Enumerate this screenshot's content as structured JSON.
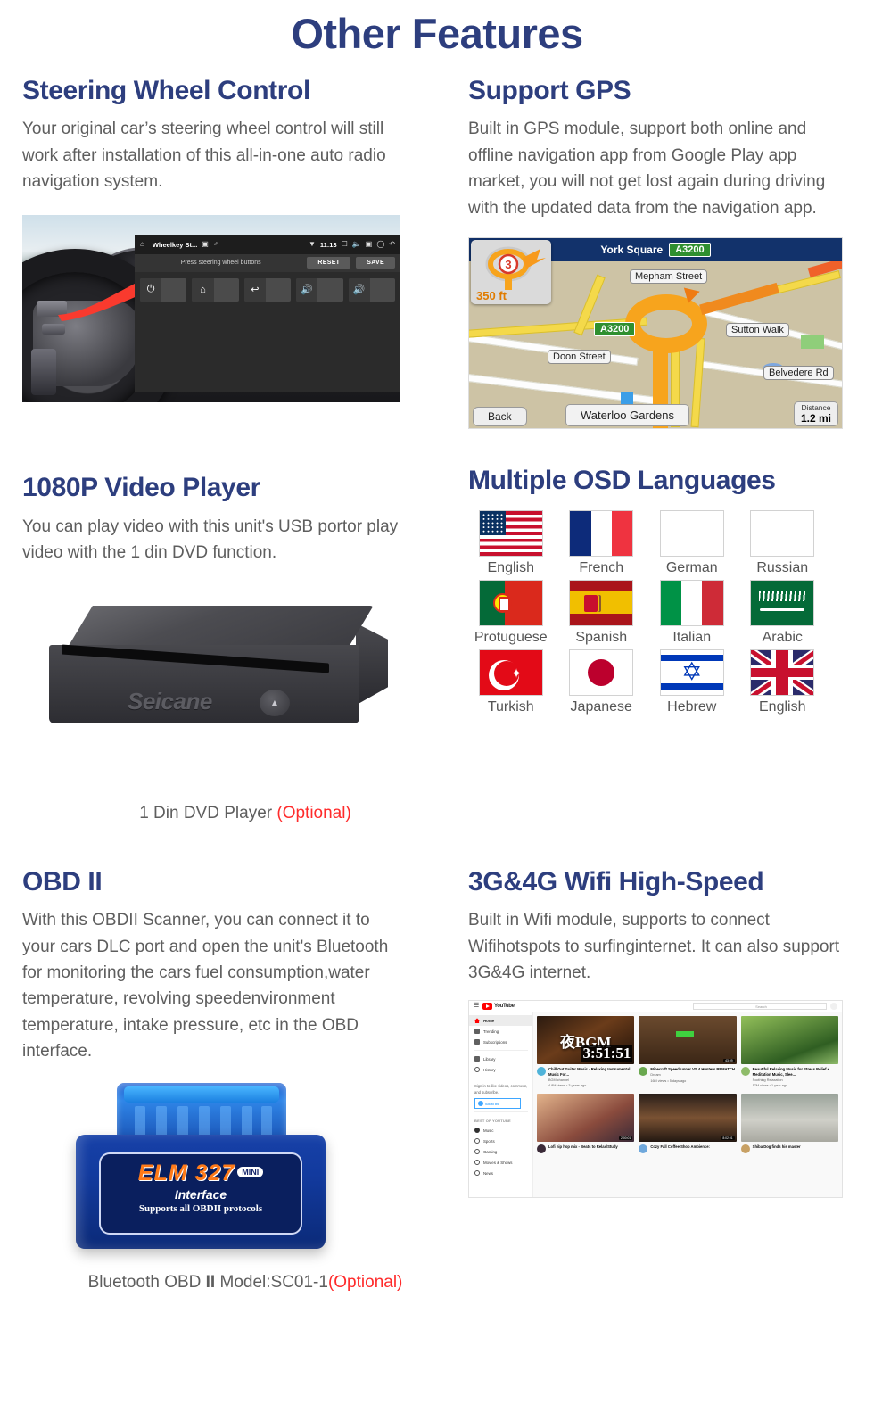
{
  "page": {
    "title": "Other Features",
    "accent_color": "#2d3e7e",
    "optional_color": "#ff2b2b"
  },
  "sections": {
    "steering": {
      "title": "Steering Wheel Control",
      "body": "Your original car’s steering wheel control will still work after installation of this all-in-one auto radio navigation system.",
      "screen": {
        "app_title": "Wheelkey St...",
        "clock": "11:13",
        "hint": "Press steering wheel buttons",
        "reset_label": "RESET",
        "save_label": "SAVE",
        "keys": [
          "power-icon",
          "home-icon",
          "back-icon",
          "volume-up-icon",
          "volume-up-icon"
        ]
      }
    },
    "gps": {
      "title": "Support GPS",
      "body": "Built in GPS module, support both online and offline navigation app from Google Play app market, you will not get lost again during driving with the updated data from the navigation app.",
      "map": {
        "header_street": "York Square",
        "header_road_badge": "A3200",
        "turn_distance": "350 ft",
        "roundabout_exit": "3",
        "road_badge": "A3200",
        "labels": [
          "Mepham Street",
          "Sutton Walk",
          "Doon Street",
          "Belvedere Rd",
          "Waterloo Gardens"
        ],
        "back_label": "Back",
        "distance_caption": "Distance",
        "distance_value": "1.2 mi"
      }
    },
    "video": {
      "title": "1080P Video Player",
      "body": "You can play video with this unit's  USB portor play video with the 1 din DVD function.",
      "device_brand": "Seicane",
      "caption": "1 Din DVD Player ",
      "caption_optional": "(Optional)"
    },
    "osd": {
      "title": "Multiple OSD Languages",
      "flags": [
        {
          "label": "English",
          "flag": "us"
        },
        {
          "label": "French",
          "flag": "fr"
        },
        {
          "label": "German",
          "flag": "de"
        },
        {
          "label": "Russian",
          "flag": "ru"
        },
        {
          "label": "Protuguese",
          "flag": "pt"
        },
        {
          "label": "Spanish",
          "flag": "es"
        },
        {
          "label": "Italian",
          "flag": "it"
        },
        {
          "label": "Arabic",
          "flag": "sa"
        },
        {
          "label": "Turkish",
          "flag": "tr"
        },
        {
          "label": "Japanese",
          "flag": "jp"
        },
        {
          "label": "Hebrew",
          "flag": "il"
        },
        {
          "label": "English",
          "flag": "uk"
        }
      ]
    },
    "obd": {
      "title": "OBD II",
      "body": "With this OBDII Scanner, you can connect it to your cars DLC port and open the unit's Bluetooth for monitoring the cars fuel consumption,water temperature, revolving speedenvironment temperature, intake pressure, etc in the OBD interface.",
      "device": {
        "brand": "ELM 327",
        "mini": "MINI",
        "interface": "Interface",
        "protocols": "Supports all OBDII protocols"
      },
      "caption": "Bluetooth OBD ",
      "caption_bold": "II",
      "caption2": " Model:SC01-1",
      "caption_optional": "(Optional)"
    },
    "wifi": {
      "title": "3G&4G Wifi High-Speed",
      "body": "Built in Wifi module, supports to connect  Wifihotspots to surfinginternet. It can also support 3G&4G internet.",
      "youtube": {
        "wordmark": "YouTube",
        "search_placeholder": "Search",
        "nav": [
          {
            "label": "Home",
            "icon": "home-icon"
          },
          {
            "label": "Trending",
            "icon": "trending-icon"
          },
          {
            "label": "Subscriptions",
            "icon": "subscriptions-icon"
          },
          {
            "label": "Library",
            "icon": "library-icon"
          },
          {
            "label": "History",
            "icon": "history-icon"
          }
        ],
        "signin_note": "Sign in to like videos, comment, and subscribe.",
        "signin_label": "SIGN IN",
        "section_label": "BEST OF YOUTUBE",
        "categories": [
          "Music",
          "Sports",
          "Gaming",
          "Movies & Shows",
          "News"
        ],
        "videos": [
          {
            "title": "Chill Out Guitar Music - Relaxing Instrumental Music For...",
            "channel": "BGM channel",
            "stats": "4.8M views • 3 years ago",
            "duration": "3:51:51",
            "thumb": "bgm"
          },
          {
            "title": "Minecraft Speedrunner VS 4 Hunters REMATCH",
            "channel": "Dream",
            "stats": "16M views • 5 days ago",
            "duration": "43:09",
            "thumb": "minecraft"
          },
          {
            "title": "Beautiful Relaxing Music for Stress Relief • Meditation Music, Slee...",
            "channel": "Soothing Relaxation",
            "stats": "17M views • 1 year ago",
            "duration": "",
            "thumb": "nature"
          },
          {
            "title": "Lofi hip hop mix - Beats to Relax/Study",
            "channel": "",
            "stats": "",
            "duration": "2:00:01",
            "thumb": "lofi"
          },
          {
            "title": "Cozy Fall Coffee Shop Ambience:",
            "channel": "",
            "stats": "",
            "duration": "8:02:01",
            "thumb": "cafe"
          },
          {
            "title": "Shiba Dog finds his master",
            "channel": "",
            "stats": "",
            "duration": "",
            "thumb": "dog"
          }
        ]
      }
    }
  }
}
